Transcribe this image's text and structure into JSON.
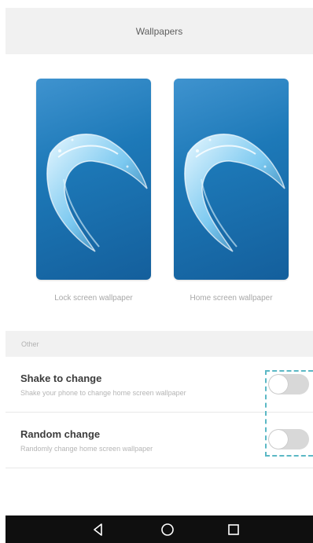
{
  "header": {
    "title": "Wallpapers"
  },
  "wallpapers": [
    {
      "label": "Lock screen wallpaper",
      "icon": "water-splash-image"
    },
    {
      "label": "Home screen wallpaper",
      "icon": "water-splash-image"
    }
  ],
  "other_section": {
    "title": "Other",
    "settings": [
      {
        "title": "Shake to change",
        "subtitle": "Shake your phone to change home screen wallpaper",
        "enabled": false
      },
      {
        "title": "Random change",
        "subtitle": "Randomly change home screen wallpaper",
        "enabled": false
      }
    ]
  },
  "navbar": {
    "buttons": [
      "back-icon",
      "home-icon",
      "recent-apps-icon"
    ]
  },
  "colors": {
    "header_bg": "#f1f1f1",
    "toggle_off": "#d8d8d8",
    "highlight_dash": "#5bb8c5",
    "navbar_bg": "#0f0f0f",
    "wallpaper_blue": "#1d79b8"
  }
}
